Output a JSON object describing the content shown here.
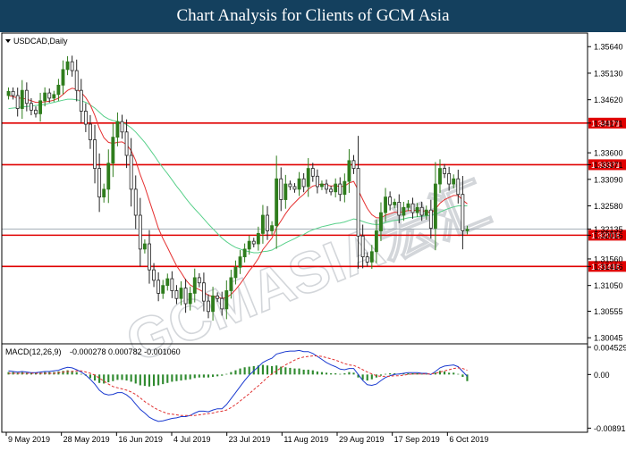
{
  "header": {
    "title": "Chart Analysis for Clients of GCM Asia"
  },
  "watermark": {
    "text": "GCMASIA宏汇"
  },
  "colors": {
    "banner_bg": "#14405e",
    "candle_up": "#2f7d1d",
    "candle_down": "#222222",
    "ma_red": "#e53030",
    "ma_green": "#58d08a",
    "level_line": "#e00000",
    "level_badge": "#e00000",
    "price_badge": "#c8d0d8",
    "macd_hist": "#2f8a2f",
    "macd_line": "#1a3ad0",
    "macd_signal": "#e03030"
  },
  "chart_data": [
    {
      "type": "candlestick",
      "title": "USDCAD,Daily",
      "ylim": [
        1.2998,
        1.3585
      ],
      "yticks": [
        "1.35640",
        "1.35130",
        "1.34620",
        "1.34171",
        "1.33600",
        "1.33371",
        "1.33090",
        "1.32580",
        "1.32135",
        "1.32016",
        "1.31560",
        "1.31416",
        "1.31050",
        "1.30555",
        "1.30045"
      ],
      "current_price": "1.32135",
      "levels": [
        {
          "value": 1.34171,
          "label": "1.34171"
        },
        {
          "value": 1.33371,
          "label": "1.33371"
        },
        {
          "value": 1.32016,
          "label": "1.32016"
        },
        {
          "value": 1.31416,
          "label": "1.31416"
        }
      ],
      "xlabels": [
        "9 May 2019",
        "28 May 2019",
        "16 Jun 2019",
        "4 Jul 2019",
        "23 Jul 2019",
        "11 Aug 2019",
        "29 Aug 2019",
        "17 Sep 2019",
        "6 Oct 2019"
      ],
      "close": [
        1.3478,
        1.347,
        1.3445,
        1.348,
        1.3455,
        1.3442,
        1.3435,
        1.346,
        1.3475,
        1.3465,
        1.3472,
        1.349,
        1.352,
        1.3535,
        1.3518,
        1.348,
        1.344,
        1.3415,
        1.3385,
        1.333,
        1.3275,
        1.329,
        1.334,
        1.339,
        1.342,
        1.34,
        1.3355,
        1.329,
        1.324,
        1.3175,
        1.3185,
        1.3135,
        1.3115,
        1.309,
        1.3105,
        1.3118,
        1.3095,
        1.308,
        1.31,
        1.307,
        1.309,
        1.312,
        1.311,
        1.3075,
        1.3055,
        1.3085,
        1.308,
        1.306,
        1.3095,
        1.312,
        1.314,
        1.316,
        1.3175,
        1.319,
        1.3185,
        1.3205,
        1.324,
        1.321,
        1.322,
        1.331,
        1.327,
        1.33,
        1.3295,
        1.329,
        1.331,
        1.3295,
        1.333,
        1.3315,
        1.3295,
        1.33,
        1.329,
        1.3285,
        1.33,
        1.328,
        1.3305,
        1.3345,
        1.333,
        1.32,
        1.316,
        1.315,
        1.317,
        1.321,
        1.3245,
        1.3275,
        1.326,
        1.3265,
        1.324,
        1.3255,
        1.3262,
        1.3245,
        1.3255,
        1.324,
        1.325,
        1.3215,
        1.33,
        1.333,
        1.332,
        1.33,
        1.331,
        1.328,
        1.321,
        1.3213
      ],
      "ma_fast": [
        1.347,
        1.3468,
        1.3465,
        1.3465,
        1.3463,
        1.346,
        1.3457,
        1.3457,
        1.3458,
        1.3459,
        1.3461,
        1.3465,
        1.3472,
        1.348,
        1.3484,
        1.3482,
        1.3476,
        1.3466,
        1.3452,
        1.3432,
        1.3407,
        1.3389,
        1.338,
        1.3378,
        1.338,
        1.3381,
        1.3376,
        1.3364,
        1.3345,
        1.3318,
        1.3295,
        1.3268,
        1.3242,
        1.3215,
        1.3195,
        1.3178,
        1.316,
        1.3143,
        1.313,
        1.3116,
        1.3106,
        1.3101,
        1.3097,
        1.3092,
        1.3086,
        1.3084,
        1.3083,
        1.308,
        1.3082,
        1.3088,
        1.3097,
        1.3108,
        1.312,
        1.3133,
        1.3144,
        1.3157,
        1.3174,
        1.3185,
        1.3196,
        1.3216,
        1.3229,
        1.3243,
        1.3255,
        1.3264,
        1.3273,
        1.328,
        1.329,
        1.3296,
        1.3298,
        1.33,
        1.3298,
        1.3296,
        1.3297,
        1.3295,
        1.3296,
        1.3302,
        1.3305,
        1.3288,
        1.327,
        1.3253,
        1.3241,
        1.3235,
        1.3235,
        1.324,
        1.3243,
        1.3246,
        1.3245,
        1.3247,
        1.3249,
        1.3249,
        1.325,
        1.3248,
        1.3248,
        1.3244,
        1.3252,
        1.3263,
        1.327,
        1.3274,
        1.3278,
        1.3278,
        1.3269,
        1.3262
      ],
      "ma_slow": [
        1.3445,
        1.3446,
        1.3447,
        1.3448,
        1.3449,
        1.345,
        1.3451,
        1.3452,
        1.3453,
        1.3455,
        1.3457,
        1.3459,
        1.3461,
        1.3463,
        1.3463,
        1.3462,
        1.346,
        1.3457,
        1.3452,
        1.3446,
        1.3438,
        1.343,
        1.3425,
        1.3422,
        1.342,
        1.3418,
        1.3414,
        1.3408,
        1.34,
        1.339,
        1.338,
        1.3368,
        1.3356,
        1.3343,
        1.3331,
        1.332,
        1.3308,
        1.3296,
        1.3285,
        1.3273,
        1.3262,
        1.3252,
        1.3243,
        1.3233,
        1.3223,
        1.3214,
        1.3205,
        1.3196,
        1.3189,
        1.3183,
        1.3178,
        1.3175,
        1.3172,
        1.317,
        1.3168,
        1.3168,
        1.317,
        1.3171,
        1.3173,
        1.3178,
        1.3182,
        1.3187,
        1.3191,
        1.3195,
        1.32,
        1.3203,
        1.3208,
        1.3212,
        1.3215,
        1.3218,
        1.322,
        1.3222,
        1.3224,
        1.3225,
        1.3227,
        1.323,
        1.3233,
        1.3231,
        1.3228,
        1.3225,
        1.3223,
        1.3222,
        1.3223,
        1.3226,
        1.3228,
        1.323,
        1.3231,
        1.3233,
        1.3235,
        1.3236,
        1.3237,
        1.3238,
        1.3239,
        1.3239,
        1.3242,
        1.3246,
        1.325,
        1.3253,
        1.3256,
        1.3258,
        1.3258,
        1.3258
      ]
    },
    {
      "type": "macd",
      "title": "MACD(12,26,9)",
      "values_label": "-0.000278 0.000782 -0.001060",
      "ylim": [
        -0.0093,
        0.0048
      ],
      "yticks": [
        "0.004529",
        "0.00",
        "-0.008915"
      ],
      "hist": [
        0.0004,
        0.0004,
        0.0003,
        0.0004,
        0.0003,
        0.0003,
        0.0003,
        0.0003,
        0.0004,
        0.0004,
        0.0004,
        0.0005,
        0.0006,
        0.0007,
        0.0006,
        0.0004,
        0.0001,
        -0.0002,
        -0.0006,
        -0.001,
        -0.0014,
        -0.0015,
        -0.0013,
        -0.0011,
        -0.0009,
        -0.0009,
        -0.001,
        -0.0012,
        -0.0015,
        -0.0018,
        -0.0019,
        -0.002,
        -0.0019,
        -0.0018,
        -0.0016,
        -0.0014,
        -0.0012,
        -0.0011,
        -0.001,
        -0.0009,
        -0.0008,
        -0.0006,
        -0.0005,
        -0.0005,
        -0.0005,
        -0.0004,
        -0.0003,
        -0.0002,
        0.0001,
        0.0004,
        0.0007,
        0.001,
        0.0012,
        0.0013,
        0.0014,
        0.0015,
        0.0016,
        0.0015,
        0.0014,
        0.0015,
        0.0013,
        0.0012,
        0.0011,
        0.001,
        0.001,
        0.0008,
        0.0008,
        0.0007,
        0.0005,
        0.0004,
        0.0003,
        0.0002,
        0.0002,
        0.0001,
        0.0002,
        0.0004,
        0.0003,
        -0.0005,
        -0.0009,
        -0.001,
        -0.0008,
        -0.0005,
        -0.0002,
        0.0001,
        0.0002,
        0.0002,
        0.0001,
        0.0002,
        0.0002,
        0.0002,
        0.0002,
        0.0001,
        0.0001,
        0.0,
        0.0003,
        0.0006,
        0.0005,
        0.0003,
        0.0003,
        0.0001,
        -0.0004,
        -0.0011
      ],
      "macd": [
        0.0006,
        0.0005,
        0.0004,
        0.0005,
        0.0004,
        0.0003,
        0.0003,
        0.0004,
        0.0005,
        0.0005,
        0.0006,
        0.0007,
        0.001,
        0.0012,
        0.0011,
        0.0008,
        0.0004,
        -0.0001,
        -0.0008,
        -0.0016,
        -0.0026,
        -0.0032,
        -0.0034,
        -0.0033,
        -0.003,
        -0.003,
        -0.0034,
        -0.004,
        -0.0049,
        -0.0058,
        -0.0064,
        -0.0071,
        -0.0075,
        -0.0078,
        -0.0077,
        -0.0075,
        -0.0073,
        -0.0072,
        -0.007,
        -0.007,
        -0.0068,
        -0.0064,
        -0.0061,
        -0.0061,
        -0.0062,
        -0.0059,
        -0.0057,
        -0.0057,
        -0.005,
        -0.004,
        -0.003,
        -0.002,
        -0.001,
        -0.0001,
        0.0006,
        0.0013,
        0.002,
        0.0024,
        0.0027,
        0.0034,
        0.0036,
        0.0038,
        0.0039,
        0.0039,
        0.004,
        0.0038,
        0.0038,
        0.0035,
        0.003,
        0.0025,
        0.002,
        0.0016,
        0.0013,
        0.0009,
        0.0008,
        0.001,
        0.001,
        0.0,
        -0.001,
        -0.0017,
        -0.0018,
        -0.0016,
        -0.001,
        -0.0005,
        -0.0002,
        0.0,
        0.0001,
        0.0002,
        0.0003,
        0.0003,
        0.0003,
        0.0002,
        0.0002,
        0.0,
        0.0005,
        0.0011,
        0.0014,
        0.0015,
        0.0016,
        0.0013,
        0.0005,
        -0.0003
      ],
      "signal": [
        0.0002,
        0.0002,
        0.0002,
        0.0002,
        0.0002,
        0.0002,
        0.0002,
        0.0002,
        0.0002,
        0.0002,
        0.0002,
        0.0003,
        0.0004,
        0.0005,
        0.0005,
        0.0006,
        0.0006,
        0.0004,
        0.0002,
        -0.0001,
        -0.0006,
        -0.0011,
        -0.0016,
        -0.002,
        -0.0022,
        -0.0024,
        -0.0026,
        -0.0029,
        -0.0033,
        -0.0039,
        -0.0045,
        -0.005,
        -0.0055,
        -0.0059,
        -0.0062,
        -0.0065,
        -0.0066,
        -0.0067,
        -0.0068,
        -0.0068,
        -0.0068,
        -0.0068,
        -0.0067,
        -0.0066,
        -0.0065,
        -0.0064,
        -0.0062,
        -0.0061,
        -0.0059,
        -0.0055,
        -0.005,
        -0.0044,
        -0.0038,
        -0.0032,
        -0.0025,
        -0.0019,
        -0.0012,
        -0.0005,
        0.0001,
        0.0006,
        0.0011,
        0.0016,
        0.002,
        0.0024,
        0.0027,
        0.0029,
        0.003,
        0.0031,
        0.0031,
        0.003,
        0.0028,
        0.0026,
        0.0024,
        0.0021,
        0.0018,
        0.0016,
        0.0015,
        0.0012,
        0.0008,
        0.0004,
        0.0001,
        -0.0002,
        -0.0003,
        -0.0003,
        -0.0003,
        -0.0002,
        -0.0002,
        -0.0001,
        0.0,
        0.0001,
        0.0001,
        0.0001,
        0.0001,
        0.0001,
        0.0002,
        0.0004,
        0.0006,
        0.0008,
        0.001,
        0.0011,
        0.001,
        0.0007
      ]
    }
  ]
}
